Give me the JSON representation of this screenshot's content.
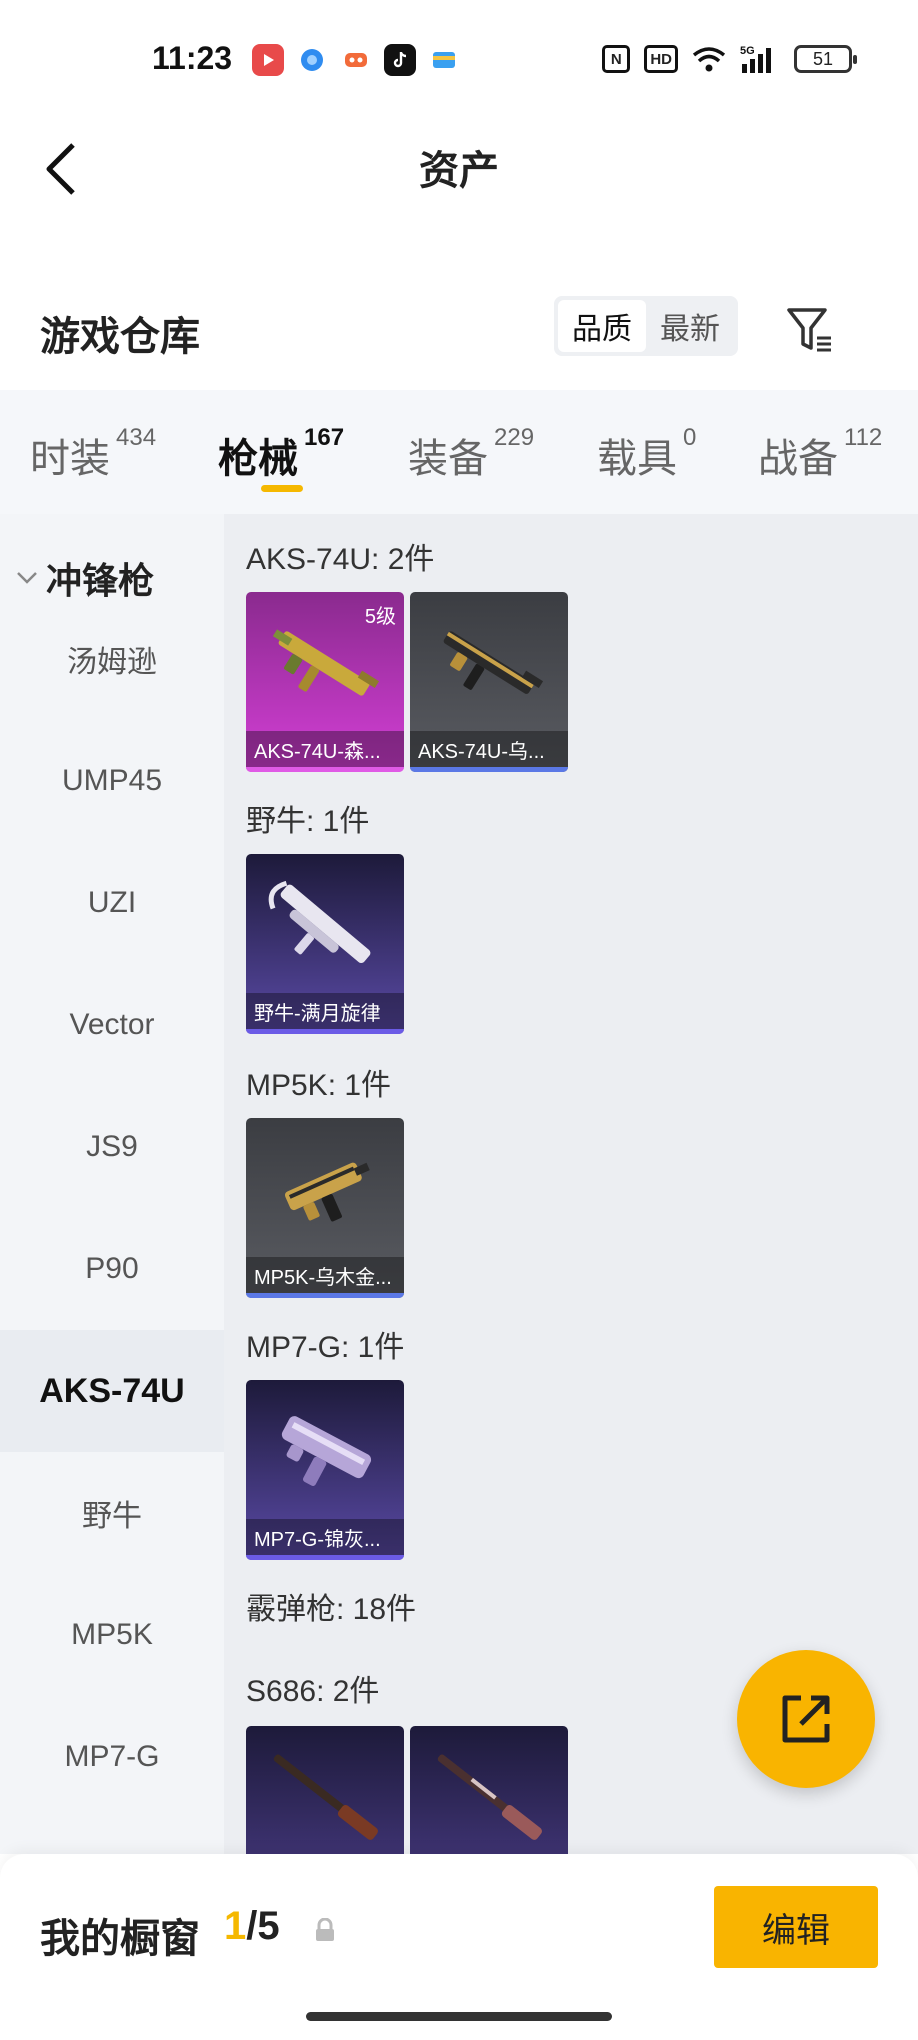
{
  "status_bar": {
    "time": "11:23",
    "battery": "51"
  },
  "nav": {
    "title": "资产"
  },
  "warehouse": {
    "title": "游戏仓库",
    "sort_options": [
      "品质",
      "最新"
    ]
  },
  "tabs": [
    {
      "label": "时装",
      "count": "434"
    },
    {
      "label": "枪械",
      "count": "167"
    },
    {
      "label": "装备",
      "count": "229"
    },
    {
      "label": "载具",
      "count": "0"
    },
    {
      "label": "战备",
      "count": "112"
    }
  ],
  "sidebar": {
    "group_label": "冲锋枪",
    "items": [
      "汤姆逊",
      "UMP45",
      "UZI",
      "Vector",
      "JS9",
      "P90",
      "AKS-74U",
      "野牛",
      "MP5K",
      "MP7-G"
    ]
  },
  "sections": [
    {
      "title": "AKS-74U: 2件",
      "items": [
        {
          "name": "AKS-74U-森...",
          "level": "5级"
        },
        {
          "name": "AKS-74U-乌..."
        }
      ]
    },
    {
      "title": "野牛: 1件",
      "items": [
        {
          "name": "野牛-满月旋律"
        }
      ]
    },
    {
      "title": "MP5K: 1件",
      "items": [
        {
          "name": "MP5K-乌木金..."
        }
      ]
    },
    {
      "title": "MP7-G: 1件",
      "items": [
        {
          "name": "MP7-G-锦灰..."
        }
      ]
    },
    {
      "title": "霰弹枪: 18件"
    },
    {
      "title": "S686: 2件"
    }
  ],
  "bottom": {
    "showcase_label": "我的橱窗",
    "current": "1",
    "total": "/5",
    "edit_label": "编辑"
  },
  "colors": {
    "accent": "#f9b400",
    "purple_card": "#c43bc7",
    "violet_card": "#4a3c86",
    "gray_card": "#4f5157"
  }
}
